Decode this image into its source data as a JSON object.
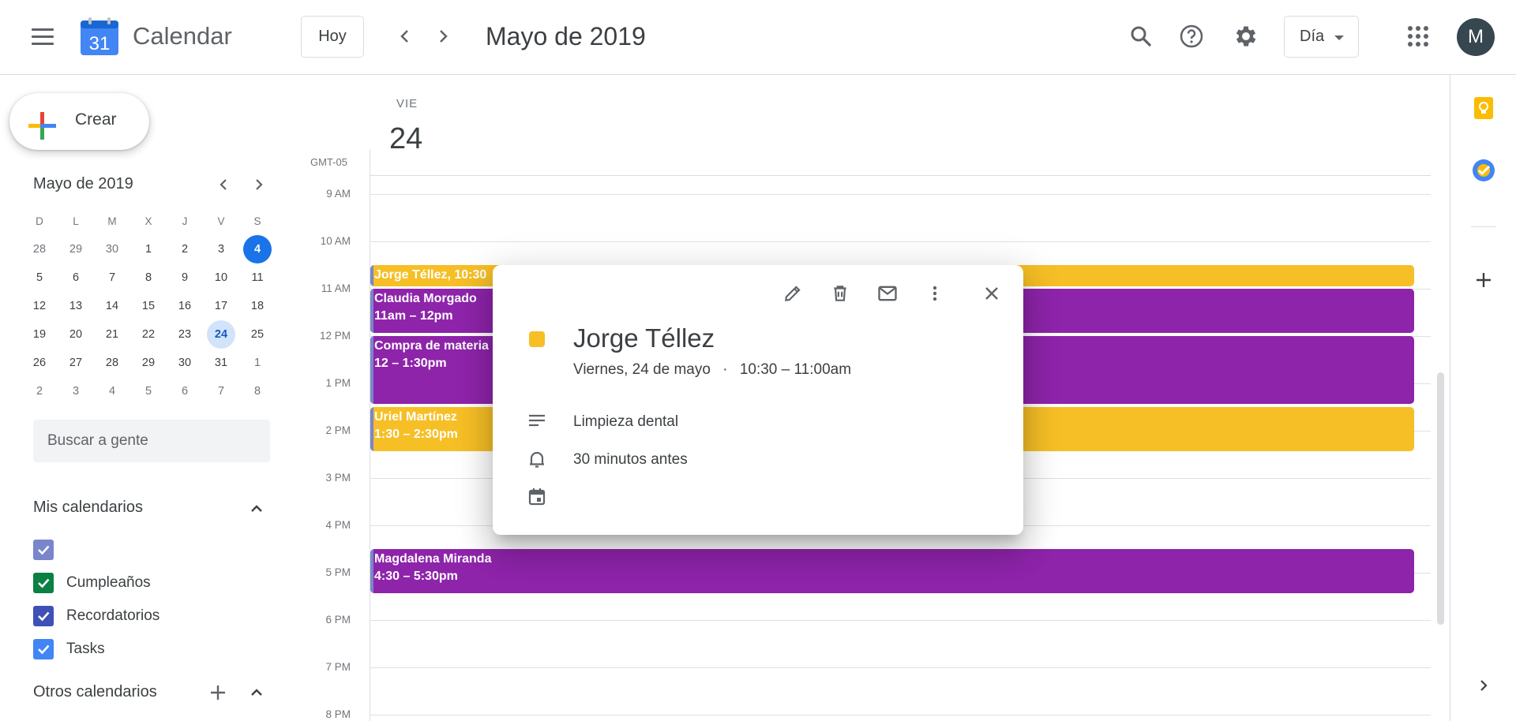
{
  "header": {
    "app_title": "Calendar",
    "logo_day": "31",
    "today_button": "Hoy",
    "current_period": "Mayo de 2019",
    "view_selector": "Día",
    "avatar_letter": "M"
  },
  "sidebar": {
    "create_label": "Crear",
    "mini_calendar": {
      "title": "Mayo de 2019",
      "weekday_headers": [
        "D",
        "L",
        "M",
        "X",
        "J",
        "V",
        "S"
      ],
      "weeks": [
        [
          "28",
          "29",
          "30",
          "1",
          "2",
          "3",
          "4"
        ],
        [
          "5",
          "6",
          "7",
          "8",
          "9",
          "10",
          "11"
        ],
        [
          "12",
          "13",
          "14",
          "15",
          "16",
          "17",
          "18"
        ],
        [
          "19",
          "20",
          "21",
          "22",
          "23",
          "24",
          "25"
        ],
        [
          "26",
          "27",
          "28",
          "29",
          "30",
          "31",
          "1"
        ],
        [
          "2",
          "3",
          "4",
          "5",
          "6",
          "7",
          "8"
        ]
      ],
      "today": "4",
      "selected": "24"
    },
    "search_people_placeholder": "Buscar a gente",
    "my_calendars": {
      "title": "Mis calendarios",
      "items": [
        {
          "label": "",
          "color": "#7986cb"
        },
        {
          "label": "Cumpleaños",
          "color": "#0b8043"
        },
        {
          "label": "Recordatorios",
          "color": "#3f51b5"
        },
        {
          "label": "Tasks",
          "color": "#4285f4"
        }
      ]
    },
    "other_calendars": {
      "title": "Otros calendarios"
    }
  },
  "day_view": {
    "weekday": "VIE",
    "day_number": "24",
    "timezone": "GMT-05",
    "hours": [
      "9 AM",
      "10 AM",
      "11 AM",
      "12 PM",
      "1 PM",
      "2 PM",
      "3 PM",
      "4 PM",
      "5 PM",
      "6 PM",
      "7 PM",
      "8 PM"
    ],
    "events": [
      {
        "title": "Jorge Téllez, 10:30",
        "time": "",
        "color": "#f6bf26"
      },
      {
        "title": "Claudia Morgado",
        "time": "11am – 12pm",
        "color": "#8e24aa"
      },
      {
        "title": "Compra de materia",
        "time": "12 – 1:30pm",
        "color": "#8e24aa"
      },
      {
        "title": "Uriel Martínez",
        "time": "1:30 – 2:30pm",
        "color": "#f6bf26"
      },
      {
        "title": "Magdalena Miranda",
        "time": "4:30 – 5:30pm",
        "color": "#8e24aa"
      }
    ]
  },
  "event_popup": {
    "title": "Jorge Téllez",
    "date": "Viernes, 24 de mayo",
    "separator": "·",
    "time_range": "10:30 – 11:00am",
    "description": "Limpieza dental",
    "reminder": "30 minutos antes",
    "color": "#f6bf26"
  }
}
